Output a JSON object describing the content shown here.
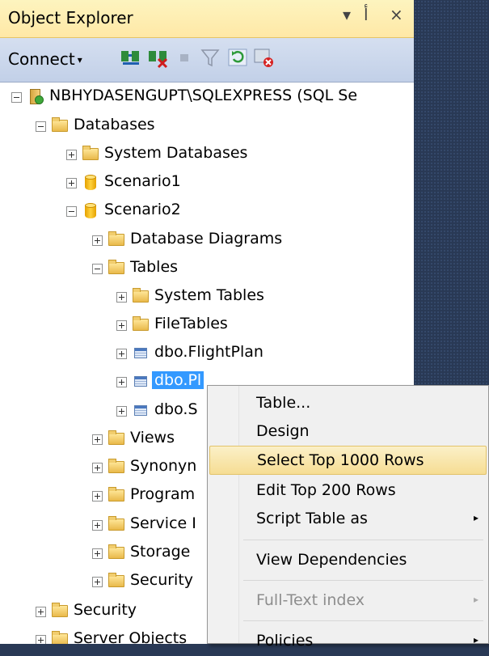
{
  "window": {
    "title": "Object Explorer",
    "pin_glyph": "▾ أ",
    "dropdown_glyph": "▾",
    "pushpin_glyph": "أ",
    "close_glyph": "×"
  },
  "toolbar": {
    "connect_label": "Connect",
    "connect_arrow": "▾"
  },
  "tree": {
    "server": "NBHYDASENGUPT\\SQLEXPRESS (SQL Se",
    "databases": "Databases",
    "system_databases": "System Databases",
    "scenario1": "Scenario1",
    "scenario2": "Scenario2",
    "database_diagrams": "Database Diagrams",
    "tables": "Tables",
    "system_tables": "System Tables",
    "filetables": "FileTables",
    "flightplan": "dbo.FlightPlan",
    "selected_table": "dbo.Pl",
    "table_s": "dbo.S",
    "views": "Views",
    "synonyms": "Synonyn",
    "programmability": "Program",
    "service_broker": "Service I",
    "storage": "Storage",
    "security_inner": "Security",
    "security": "Security",
    "server_objects": "Server Objects"
  },
  "context_menu": {
    "items": [
      {
        "label": "Table...",
        "state": "normal"
      },
      {
        "label": "Design",
        "state": "normal"
      },
      {
        "label": "Select Top 1000 Rows",
        "state": "hover"
      },
      {
        "label": "Edit Top 200 Rows",
        "state": "normal"
      },
      {
        "label": "Script Table as",
        "state": "normal",
        "submenu": true
      },
      {
        "label": "View Dependencies",
        "state": "normal"
      },
      {
        "label": "Full-Text index",
        "state": "disabled",
        "submenu": true
      },
      {
        "label": "Policies",
        "state": "normal",
        "submenu": true
      }
    ],
    "submenu_glyph": "▸"
  },
  "colors": {
    "selection": "#3399ff",
    "hover": "#f6dd93",
    "background": "#293955"
  }
}
